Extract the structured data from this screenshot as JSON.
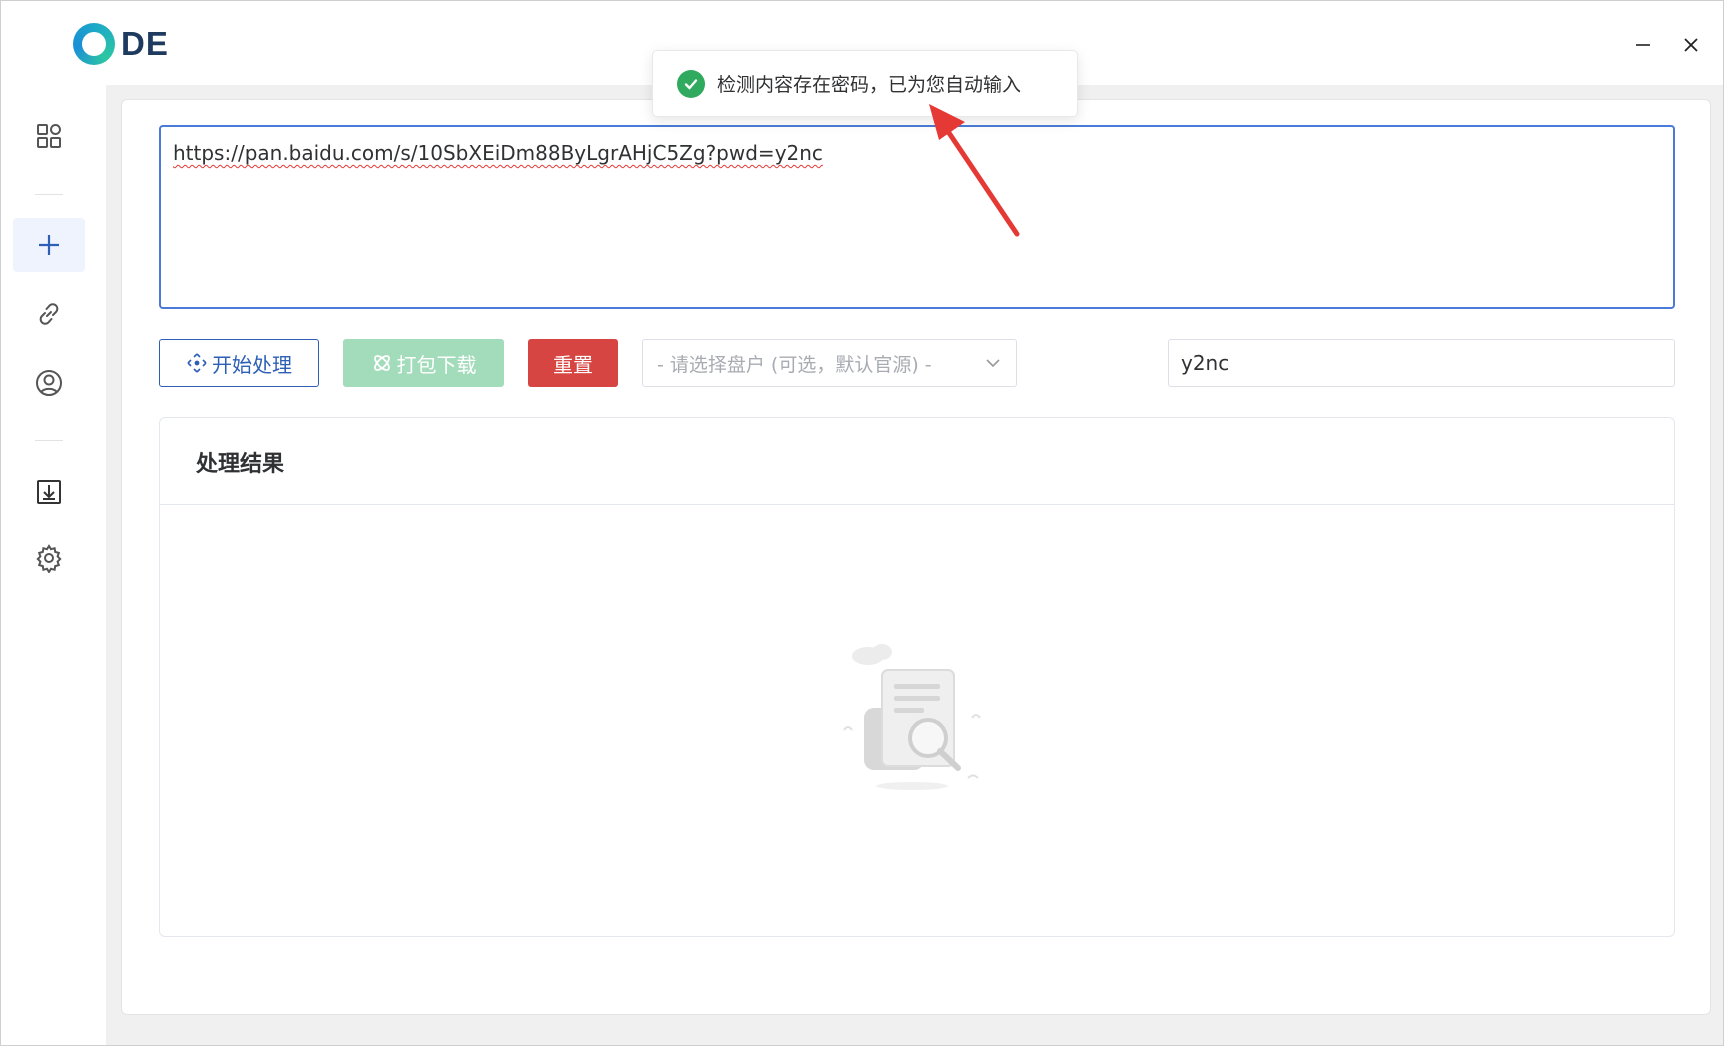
{
  "app": {
    "logo_text": "DE",
    "window_controls": {
      "minimize": "—",
      "close": "✕"
    }
  },
  "sidebar": {
    "items": [
      {
        "name": "dashboard",
        "icon": "grid-icon",
        "active": false
      },
      {
        "name": "new-task",
        "icon": "plus-icon",
        "active": true
      },
      {
        "name": "links",
        "icon": "link-icon",
        "active": false
      },
      {
        "name": "account",
        "icon": "user-circle-icon",
        "active": false
      },
      {
        "name": "downloads",
        "icon": "download-box-icon",
        "active": false
      },
      {
        "name": "settings",
        "icon": "gear-icon",
        "active": false
      }
    ]
  },
  "main": {
    "url_value": "https://pan.baidu.com/s/10SbXEiDm88ByLgrAHjC5Zg?pwd=y2nc",
    "buttons": {
      "start": "开始处理",
      "pack_download": "打包下载",
      "reset": "重置"
    },
    "drive_select": {
      "placeholder": "- 请选择盘户 (可选，默认官源) -"
    },
    "password_value": "y2nc",
    "result": {
      "title": "处理结果"
    }
  },
  "toast": {
    "message": "检测内容存在密码，已为您自动输入",
    "icon": "check-circle-icon"
  },
  "colors": {
    "primary": "#2d5fb6",
    "success": "#2faa5e",
    "danger": "#d64541",
    "pack_disabled": "#a3dcbb",
    "annotation_arrow": "#e53935"
  }
}
